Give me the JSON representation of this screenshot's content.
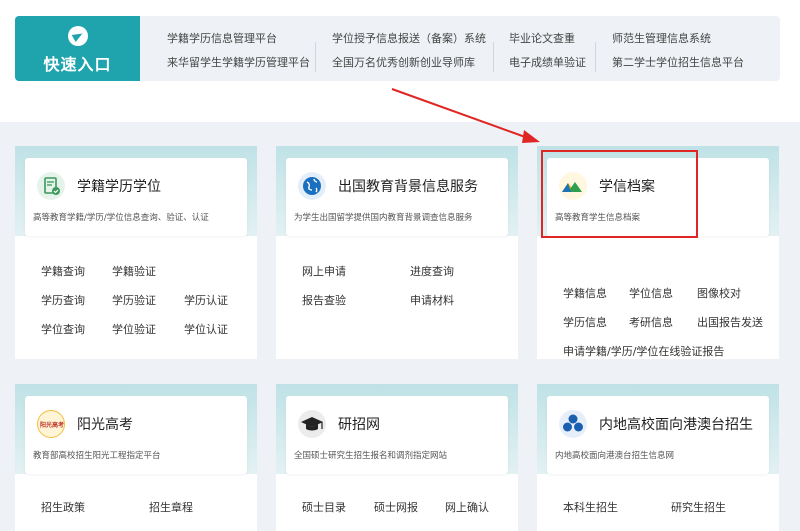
{
  "quick_entry": {
    "title": "快速入口",
    "links": [
      "学籍学历信息管理平台",
      "来华留学生学籍学历管理平台",
      "学位授予信息报送（备案）系统",
      "全国万名优秀创新创业导师库",
      "毕业论文查重",
      "电子成绩单验证",
      "师范生管理信息系统",
      "第二学士学位招生信息平台"
    ]
  },
  "cards": [
    {
      "title": "学籍学历学位",
      "subtitle": "高等教育学籍/学历/学位信息查询、验证、认证",
      "icon": "document-check-icon",
      "links": [
        "学籍查询",
        "学籍验证",
        "学历查询",
        "学历验证",
        "学历认证",
        "学位查询",
        "学位验证",
        "学位认证"
      ]
    },
    {
      "title": "出国教育背景信息服务",
      "subtitle": "为学生出国留学提供国内教育背景调查信息服务",
      "icon": "globe-icon",
      "links": [
        "网上申请",
        "进度查询",
        "报告查验",
        "申请材料"
      ]
    },
    {
      "title": "学信档案",
      "subtitle": "高等教育学生信息档案",
      "icon": "archive-mountain-icon",
      "links": [
        "学籍信息",
        "学位信息",
        "图像校对",
        "学历信息",
        "考研信息",
        "出国报告发送",
        "申请学籍/学历/学位在线验证报告"
      ]
    },
    {
      "title": "阳光高考",
      "subtitle": "教育部高校招生阳光工程指定平台",
      "icon": "sunshine-logo-icon",
      "logo_text": "阳光高考",
      "links": [
        "招生政策",
        "招生章程"
      ]
    },
    {
      "title": "研招网",
      "subtitle": "全国硕士研究生招生报名和调剂指定网站",
      "icon": "graduation-cap-icon",
      "links": [
        "硕士目录",
        "硕士网报",
        "网上确认"
      ]
    },
    {
      "title": "内地高校面向港澳台招生",
      "subtitle": "内地高校面向港澳台招生信息网",
      "icon": "flower-icon",
      "links": [
        "本科生招生",
        "研究生招生"
      ]
    }
  ]
}
